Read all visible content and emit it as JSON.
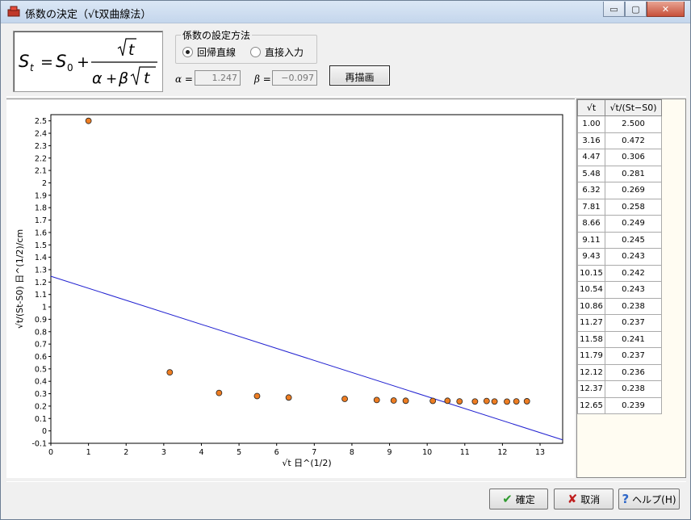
{
  "window": {
    "title": "係数の決定（√t双曲線法）",
    "minimize_label": "▭",
    "maximize_label": "▢",
    "close_label": "✕"
  },
  "formula": {
    "lhs": "S",
    "lhs_sub": "t",
    "s0": "S",
    "s0_sub": "0",
    "numerator": "t",
    "alpha": "α",
    "beta": "β"
  },
  "settings": {
    "group_title": "係数の設定方法",
    "option_regression": "回帰直線",
    "option_direct": "直接入力",
    "selected": "regression"
  },
  "coefficients": {
    "alpha_label": "α =",
    "alpha_value": "1.247",
    "beta_label": "β =",
    "beta_value": "−0.097"
  },
  "redraw_button": "再描画",
  "table": {
    "headers": [
      "√t",
      "√t/(St−S0)"
    ],
    "rows": [
      [
        "1.00",
        "2.500"
      ],
      [
        "3.16",
        "0.472"
      ],
      [
        "4.47",
        "0.306"
      ],
      [
        "5.48",
        "0.281"
      ],
      [
        "6.32",
        "0.269"
      ],
      [
        "7.81",
        "0.258"
      ],
      [
        "8.66",
        "0.249"
      ],
      [
        "9.11",
        "0.245"
      ],
      [
        "9.43",
        "0.243"
      ],
      [
        "10.15",
        "0.242"
      ],
      [
        "10.54",
        "0.243"
      ],
      [
        "10.86",
        "0.238"
      ],
      [
        "11.27",
        "0.237"
      ],
      [
        "11.58",
        "0.241"
      ],
      [
        "11.79",
        "0.237"
      ],
      [
        "12.12",
        "0.236"
      ],
      [
        "12.37",
        "0.238"
      ],
      [
        "12.65",
        "0.239"
      ]
    ]
  },
  "buttons": {
    "ok": "確定",
    "cancel": "取消",
    "help": "ヘルプ(H)"
  },
  "icons": {
    "app": "app-icon",
    "ok": "check-icon",
    "cancel": "cross-icon",
    "help": "question-icon"
  },
  "colors": {
    "point_fill": "#ee7d22",
    "line": "#1f1fd0",
    "ok_icon": "#2e9a2e",
    "cancel_icon": "#c02020",
    "help_icon": "#2f67c8"
  },
  "chart_data": {
    "type": "scatter",
    "xlabel": "√t 日^(1/2)",
    "ylabel": "√t/(St-S0) 日^(1/2)/cm",
    "xlim": [
      0,
      13.6
    ],
    "ylim": [
      -0.1,
      2.55
    ],
    "x_ticks": [
      0,
      1,
      2,
      3,
      4,
      5,
      6,
      7,
      8,
      9,
      10,
      11,
      12,
      13
    ],
    "y_ticks": [
      -0.1,
      0,
      0.1,
      0.2,
      0.3,
      0.4,
      0.5,
      0.6,
      0.7,
      0.8,
      0.9,
      1,
      1.1,
      1.2,
      1.3,
      1.4,
      1.5,
      1.6,
      1.7,
      1.8,
      1.9,
      2,
      2.1,
      2.2,
      2.3,
      2.4,
      2.5
    ],
    "series": [
      {
        "type": "scatter",
        "x": [
          1.0,
          3.16,
          4.47,
          5.48,
          6.32,
          7.81,
          8.66,
          9.11,
          9.43,
          10.15,
          10.54,
          10.86,
          11.27,
          11.58,
          11.79,
          12.12,
          12.37,
          12.65
        ],
        "y": [
          2.5,
          0.472,
          0.306,
          0.281,
          0.269,
          0.258,
          0.249,
          0.245,
          0.243,
          0.242,
          0.243,
          0.238,
          0.237,
          0.241,
          0.237,
          0.236,
          0.238,
          0.239
        ]
      },
      {
        "type": "line",
        "x": [
          0,
          13.6
        ],
        "y": [
          1.247,
          -0.0722
        ]
      }
    ],
    "grid": false
  }
}
